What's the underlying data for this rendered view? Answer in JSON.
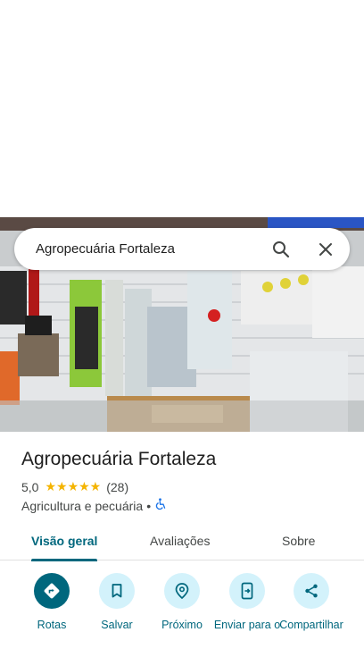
{
  "search": {
    "value": "Agropecuária Fortaleza"
  },
  "place": {
    "title": "Agropecuária Fortaleza",
    "rating": "5,0",
    "stars": "★★★★★",
    "review_count": "(28)",
    "category": "Agricultura e pecuária",
    "separator": "•"
  },
  "tabs": [
    {
      "label": "Visão geral",
      "active": true
    },
    {
      "label": "Avaliações",
      "active": false
    },
    {
      "label": "Sobre",
      "active": false
    }
  ],
  "actions": [
    {
      "label": "Rotas",
      "icon": "directions-icon"
    },
    {
      "label": "Salvar",
      "icon": "bookmark-icon"
    },
    {
      "label": "Próximo",
      "icon": "nearby-icon"
    },
    {
      "label": "Enviar para o",
      "icon": "send-to-phone-icon"
    },
    {
      "label": "Compartilhar",
      "icon": "share-icon"
    }
  ],
  "colors": {
    "accent": "#00677d",
    "action_bg": "#d3f2fb",
    "star": "#f4b400"
  }
}
